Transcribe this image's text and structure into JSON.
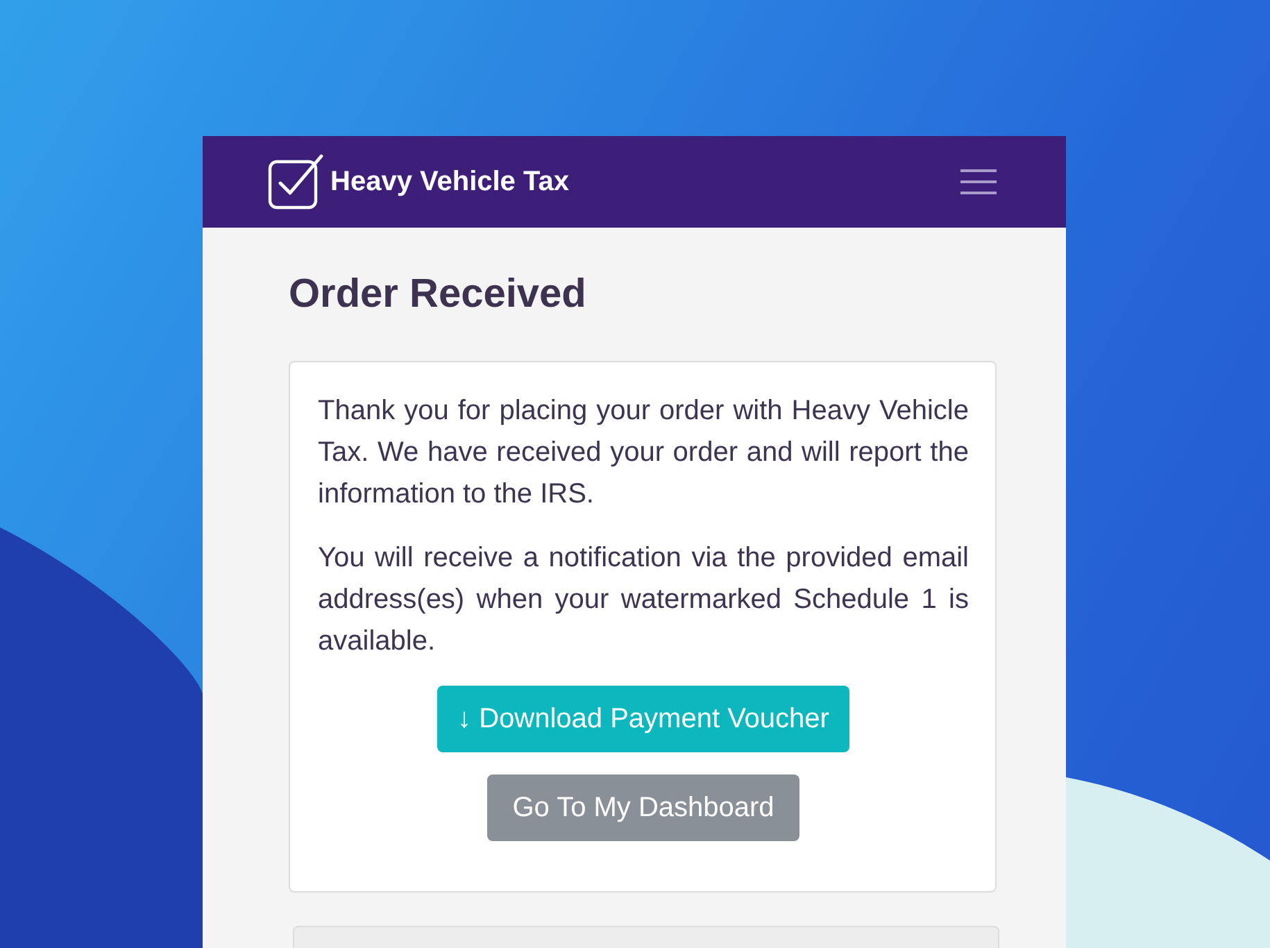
{
  "navbar": {
    "brand": "Heavy Vehicle Tax"
  },
  "page": {
    "title": "Order Received"
  },
  "message": {
    "paragraphs": [
      "Thank you for placing your order with Heavy Vehicle Tax. We have received your order and will report the information to the IRS.",
      "You will receive a notification via the provided email address(es) when your watermarked Schedule 1 is available."
    ],
    "buttons": [
      {
        "kind": "primary",
        "label": "↓ Download Payment Voucher"
      },
      {
        "kind": "secondary",
        "label": "Go To My Dashboard"
      }
    ]
  }
}
